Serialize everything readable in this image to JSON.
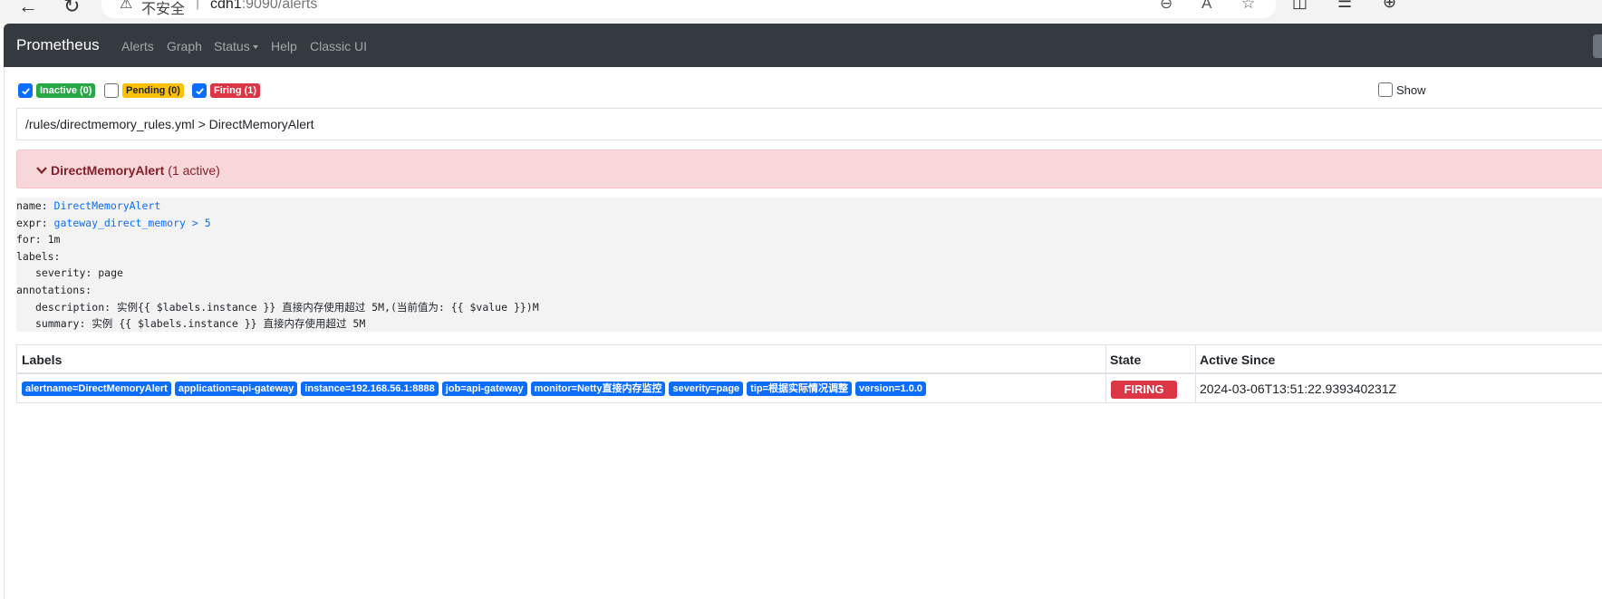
{
  "browser": {
    "insecure_label": "不安全",
    "separator": "|",
    "url_host": "cdh1",
    "url_rest": ":9090/alerts"
  },
  "navbar": {
    "brand": "Prometheus",
    "items": [
      {
        "label": "Alerts"
      },
      {
        "label": "Graph"
      },
      {
        "label": "Status"
      },
      {
        "label": "Help"
      },
      {
        "label": "Classic UI"
      }
    ]
  },
  "filters": {
    "inactive": {
      "label": "Inactive (0)",
      "checked": true
    },
    "pending": {
      "label": "Pending (0)",
      "checked": false
    },
    "firing": {
      "label": "Firing (1)",
      "checked": true
    },
    "show_annotations": {
      "label": "Show",
      "checked": false
    }
  },
  "rule_file": {
    "path": "/rules/directmemory_rules.yml > DirectMemoryAlert"
  },
  "alert_group": {
    "name": "DirectMemoryAlert",
    "active_count": "(1 active)"
  },
  "rule": {
    "name_key": "name: ",
    "name_value": "DirectMemoryAlert",
    "expr_key": "expr: ",
    "expr_value": "gateway_direct_memory > 5",
    "for_line": "for: 1m",
    "labels_line": "labels:",
    "severity_line": "severity: page",
    "annotations_line": "annotations:",
    "description_key": "description: ",
    "description_value": "实例{{ $labels.instance }} 直接内存使用超过 5M,(当前值为: {{ $value }})M",
    "summary_key": "summary: ",
    "summary_value": "实例 {{ $labels.instance }} 直接内存使用超过 5M"
  },
  "table": {
    "headers": {
      "labels": "Labels",
      "state": "State",
      "active_since": "Active Since"
    },
    "rows": [
      {
        "labels": [
          "alertname=DirectMemoryAlert",
          "application=api-gateway",
          "instance=192.168.56.1:8888",
          "job=api-gateway",
          "monitor=Netty直接内存监控",
          "severity=page",
          "tip=根据实际情况调整",
          "version=1.0.0"
        ],
        "state": "FIRING",
        "active_since": "2024-03-06T13:51:22.939340231Z"
      }
    ]
  },
  "colors": {
    "navbar_bg": "#343a40",
    "firing": "#dc3545",
    "pending": "#ffc107",
    "inactive": "#28a745",
    "label_badge": "#0d6efd",
    "alert_header_bg": "#f8d7da"
  }
}
